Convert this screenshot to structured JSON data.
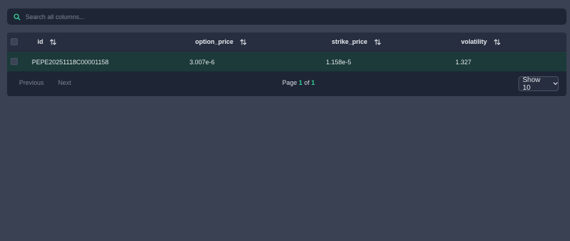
{
  "search": {
    "placeholder": "Search all columns...",
    "icon": "search-icon"
  },
  "table": {
    "columns": [
      {
        "key": "id",
        "label": "id",
        "sort_icon": "sort-arrows-icon"
      },
      {
        "key": "option_price",
        "label": "option_price",
        "sort_icon": "sort-arrows-icon"
      },
      {
        "key": "strike_price",
        "label": "strike_price",
        "sort_icon": "sort-arrows-icon"
      },
      {
        "key": "volatility",
        "label": "volatility",
        "sort_icon": "sort-arrows-icon"
      }
    ],
    "rows": [
      {
        "id": "PEPE20251118C00001158",
        "option_price": "3.007e-6",
        "strike_price": "1.158e-5",
        "volatility": "1.327",
        "selected": false
      }
    ],
    "select_all_checked": false
  },
  "pagination": {
    "previous_label": "Previous",
    "next_label": "Next",
    "page_prefix": "Page",
    "current_page": "1",
    "of_label": "of",
    "total_pages": "1",
    "page_size_label": "Show 10",
    "page_size_icon": "chevron-down-icon"
  },
  "colors": {
    "background": "#3a4152",
    "panel": "#1e2535",
    "header": "#262e3f",
    "row_highlight": "#1b3a39",
    "accent": "#34d399"
  }
}
